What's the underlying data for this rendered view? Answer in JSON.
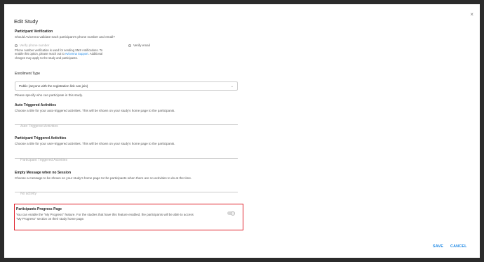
{
  "dialog": {
    "title": "Edit Study",
    "close_symbol": "×"
  },
  "verification": {
    "title": "Participant Verification",
    "question": "Should Avicenna validate each participant's phone number and email?",
    "phone_label": "Verify phone number",
    "phone_note_1": "Phone number verification is used for sending SMS notifications. To",
    "phone_note_2a": "enable this option, please reach out to ",
    "phone_note_link": "Avicenna Support",
    "phone_note_2b": ". Additional",
    "phone_note_3": "charges may apply to the study and participants.",
    "email_label": "Verify email"
  },
  "enrollment": {
    "title": "Enrollment Type",
    "selected": "Public (anyone with the registration link can join)",
    "helper": "Please specify who can participate in this study."
  },
  "auto": {
    "title": "Auto Triggered Activities",
    "desc": "Choose a title for your auto-triggered activities. This will be shown on your study's home page to the participants.",
    "placeholder": "Auto Triggered Activities"
  },
  "participant": {
    "title": "Participant Triggered Activities",
    "desc": "Choose a title for your user-triggered activities. This will be shown on your study's home page to the participants.",
    "placeholder": "Participant Triggered Activities"
  },
  "empty": {
    "title": "Empty Message when no Session",
    "desc": "Choose a message to be shown on your study's home page to the participants when there are no activities to do at the time.",
    "placeholder": "No activity"
  },
  "progress": {
    "title": "Participants Progress Page",
    "desc_1": "You can enable the \"My Progress\" feature. For the studies that have this feature enabled, the participants will be able to access",
    "desc_2": "\"My Progress\" section on their study home page.",
    "enabled": false
  },
  "footer": {
    "save": "SAVE",
    "cancel": "CANCEL"
  },
  "colors": {
    "accent": "#1e88e5",
    "highlight": "#e0202a"
  }
}
